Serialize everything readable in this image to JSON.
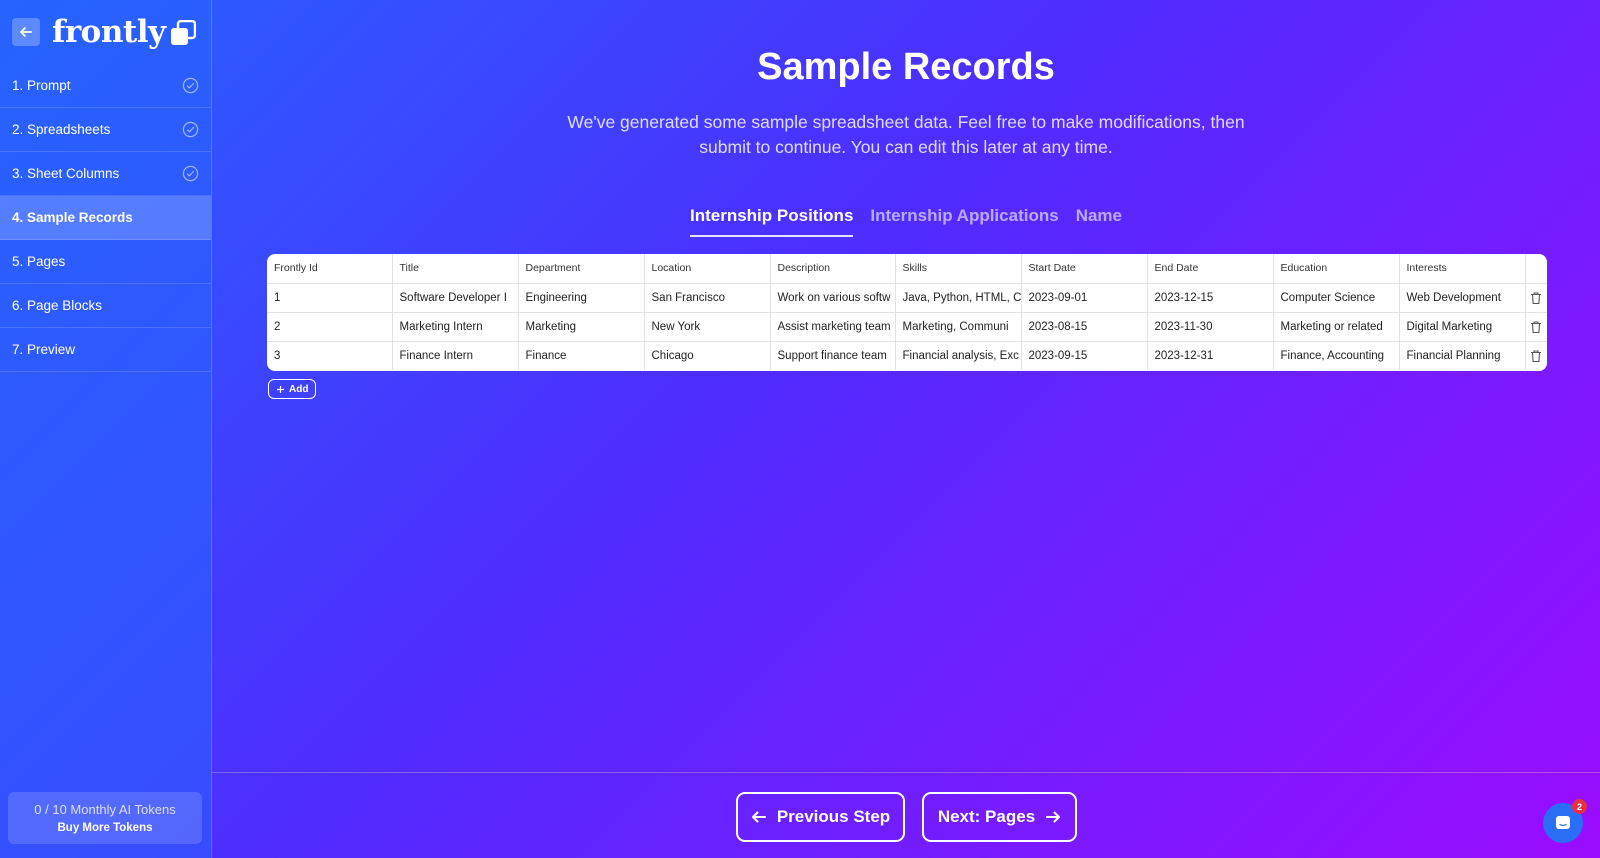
{
  "app": {
    "name": "frontly"
  },
  "sidebar": {
    "items": [
      {
        "label": "1. Prompt",
        "done": true
      },
      {
        "label": "2. Spreadsheets",
        "done": true
      },
      {
        "label": "3. Sheet Columns",
        "done": true
      },
      {
        "label": "4. Sample Records",
        "done": false,
        "active": true
      },
      {
        "label": "5. Pages",
        "done": false
      },
      {
        "label": "6. Page Blocks",
        "done": false
      },
      {
        "label": "7. Preview",
        "done": false
      }
    ],
    "tokens": {
      "count": "0 / 10 Monthly AI Tokens",
      "buy_label": "Buy More Tokens"
    }
  },
  "main": {
    "title": "Sample Records",
    "subtitle": "We've generated some sample spreadsheet data. Feel free to make modifications, then submit to continue. You can edit this later at any time.",
    "tabs": [
      {
        "label": "Internship Positions",
        "active": true
      },
      {
        "label": "Internship Applications",
        "active": false
      },
      {
        "label": "Name",
        "active": false
      }
    ],
    "table": {
      "columns": [
        "Frontly Id",
        "Title",
        "Department",
        "Location",
        "Description",
        "Skills",
        "Start Date",
        "End Date",
        "Education",
        "Interests"
      ],
      "rows": [
        [
          "1",
          "Software Developer I",
          "Engineering",
          "San Francisco",
          "Work on various softw",
          "Java, Python, HTML, C",
          "2023-09-01",
          "2023-12-15",
          "Computer Science",
          "Web Development"
        ],
        [
          "2",
          "Marketing Intern",
          "Marketing",
          "New York",
          "Assist marketing team",
          "Marketing, Communi",
          "2023-08-15",
          "2023-11-30",
          "Marketing or related",
          "Digital Marketing"
        ],
        [
          "3",
          "Finance Intern",
          "Finance",
          "Chicago",
          "Support finance team",
          "Financial analysis, Exc",
          "2023-09-15",
          "2023-12-31",
          "Finance, Accounting",
          "Financial Planning"
        ]
      ]
    },
    "add_label": "Add"
  },
  "footer": {
    "prev_label": "Previous Step",
    "next_label": "Next: Pages",
    "chat_badge": "2"
  },
  "colors": {
    "gradient_start": "#2563ff",
    "gradient_end": "#9b0cff",
    "chat": "#2b6ef6",
    "badge": "#e5304a"
  },
  "icons": [
    "arrow-left-icon",
    "logo-mark-icon",
    "check-circle-icon",
    "trash-icon",
    "plus-icon",
    "arrow-right-icon",
    "chat-icon"
  ]
}
